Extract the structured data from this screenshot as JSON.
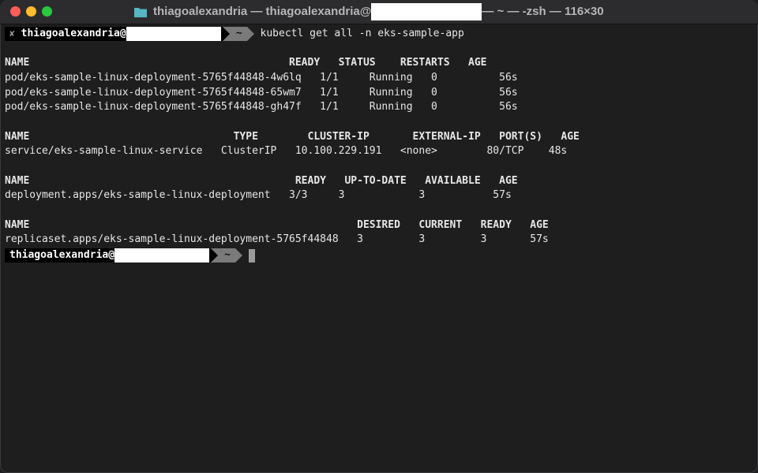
{
  "window": {
    "title_prefix": "thiagoalexandria — thiagoalexandria@",
    "title_suffix": "— ~ — -zsh — 116×30"
  },
  "prompt": {
    "user": "thiagoalexandria@",
    "dir": "~",
    "command": "kubectl get all -n eks-sample-app",
    "status_mark": "✘"
  },
  "output_lines": [
    "NAME                                          READY   STATUS    RESTARTS   AGE",
    "pod/eks-sample-linux-deployment-5765f44848-4w6lq   1/1     Running   0          56s",
    "pod/eks-sample-linux-deployment-5765f44848-65wm7   1/1     Running   0          56s",
    "pod/eks-sample-linux-deployment-5765f44848-gh47f   1/1     Running   0          56s",
    "",
    "NAME                                 TYPE        CLUSTER-IP       EXTERNAL-IP   PORT(S)   AGE",
    "service/eks-sample-linux-service   ClusterIP   10.100.229.191   <none>        80/TCP    48s",
    "",
    "NAME                                           READY   UP-TO-DATE   AVAILABLE   AGE",
    "deployment.apps/eks-sample-linux-deployment   3/3     3            3           57s",
    "",
    "NAME                                                     DESIRED   CURRENT   READY   AGE",
    "replicaset.apps/eks-sample-linux-deployment-5765f44848   3         3         3       57s"
  ]
}
